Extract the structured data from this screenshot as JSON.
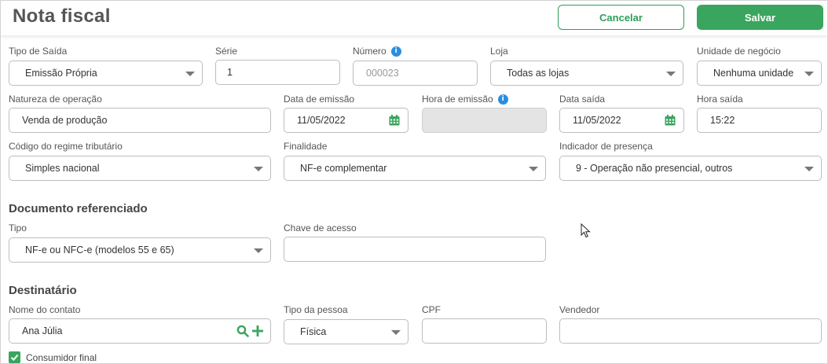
{
  "header": {
    "title": "Nota fiscal",
    "cancel_label": "Cancelar",
    "save_label": "Salvar"
  },
  "fields": {
    "tipo_saida": {
      "label": "Tipo de Saída",
      "value": "Emissão Própria"
    },
    "serie": {
      "label": "Série",
      "value": "1"
    },
    "numero": {
      "label": "Número",
      "placeholder": "000023"
    },
    "loja": {
      "label": "Loja",
      "value": "Todas as lojas"
    },
    "unidade_negocio": {
      "label": "Unidade de negócio",
      "value": "Nenhuma unidade"
    },
    "natureza_operacao": {
      "label": "Natureza de operação",
      "value": "Venda de produção"
    },
    "data_emissao": {
      "label": "Data de emissão",
      "value": "11/05/2022"
    },
    "hora_emissao": {
      "label": "Hora de emissão",
      "value": ""
    },
    "data_saida": {
      "label": "Data saída",
      "value": "11/05/2022"
    },
    "hora_saida": {
      "label": "Hora saída",
      "value": "15:22"
    },
    "regime_tributario": {
      "label": "Código do regime tributário",
      "value": "Simples nacional"
    },
    "finalidade": {
      "label": "Finalidade",
      "value": "NF-e complementar"
    },
    "indicador_presenca": {
      "label": "Indicador de presença",
      "value": "9 - Operação não presencial, outros"
    }
  },
  "documento_referenciado": {
    "title": "Documento referenciado",
    "tipo": {
      "label": "Tipo",
      "value": "NF-e ou NFC-e (modelos 55 e 65)"
    },
    "chave_acesso": {
      "label": "Chave de acesso",
      "value": ""
    }
  },
  "destinatario": {
    "title": "Destinatário",
    "nome_contato": {
      "label": "Nome do contato",
      "value": "Ana Júlia"
    },
    "tipo_pessoa": {
      "label": "Tipo da pessoa",
      "value": "Física"
    },
    "cpf": {
      "label": "CPF",
      "value": ""
    },
    "vendedor": {
      "label": "Vendedor",
      "value": ""
    },
    "consumidor_final": {
      "label": "Consumidor final",
      "checked": true
    }
  },
  "icons": {
    "info": "info-icon",
    "calendar": "calendar-icon",
    "caret": "chevron-down-icon",
    "search": "search-icon",
    "add": "plus-icon",
    "check": "check-icon"
  },
  "colors": {
    "accent_green": "#3aa55e",
    "info_blue": "#2a8ee0"
  }
}
